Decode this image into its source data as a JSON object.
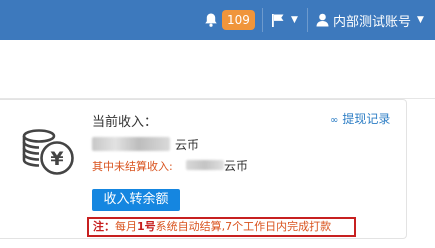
{
  "topbar": {
    "notification_count": "109",
    "user_name": "内部测试账号"
  },
  "income": {
    "current_label": "当前收入：",
    "currency_unit": "云币",
    "unsettled_label": "其中未结算收入:",
    "unsettled_unit": "云币",
    "withdraw_link": "提现记录",
    "transfer_button": "收入转余额"
  },
  "note": {
    "prefix": "注：",
    "part1": "每月",
    "day": "1号",
    "part2": "系统自动结算,7个工作日内完成打款"
  },
  "colors": {
    "topbar_bg": "#3d79bd",
    "badge_bg": "#f0953b",
    "button_bg": "#1586e0",
    "warning_text": "#d9531e",
    "note_border": "#c72020",
    "link": "#2d7ec5"
  }
}
